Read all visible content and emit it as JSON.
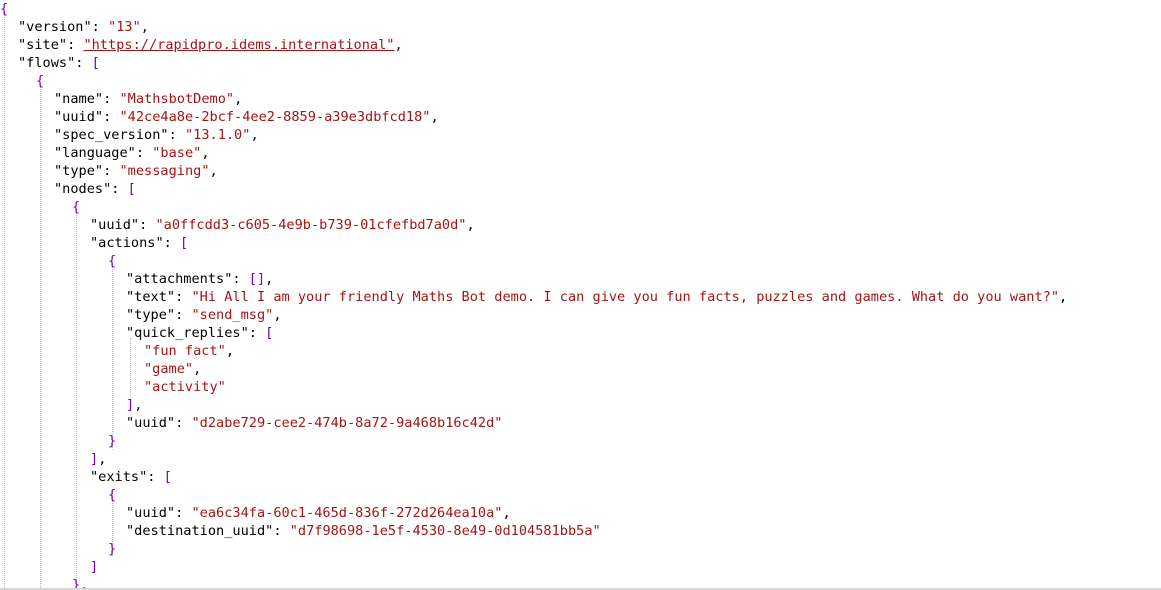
{
  "lines": [
    [
      [
        "p",
        "{"
      ]
    ],
    [
      [
        "k",
        "\"version\""
      ],
      [
        "k",
        ": "
      ],
      [
        "s",
        "\"13\""
      ],
      [
        "k",
        ","
      ]
    ],
    [
      [
        "k",
        "\"site\""
      ],
      [
        "k",
        ": "
      ],
      [
        "lnk",
        "\"https://rapidpro.idems.international\""
      ],
      [
        "k",
        ","
      ]
    ],
    [
      [
        "k",
        "\"flows\""
      ],
      [
        "k",
        ": "
      ],
      [
        "p",
        "["
      ]
    ],
    [
      [
        "p",
        "{"
      ]
    ],
    [
      [
        "k",
        "\"name\""
      ],
      [
        "k",
        ": "
      ],
      [
        "s",
        "\"MathsbotDemo\""
      ],
      [
        "k",
        ","
      ]
    ],
    [
      [
        "k",
        "\"uuid\""
      ],
      [
        "k",
        ": "
      ],
      [
        "s",
        "\"42ce4a8e-2bcf-4ee2-8859-a39e3dbfcd18\""
      ],
      [
        "k",
        ","
      ]
    ],
    [
      [
        "k",
        "\"spec_version\""
      ],
      [
        "k",
        ": "
      ],
      [
        "s",
        "\"13.1.0\""
      ],
      [
        "k",
        ","
      ]
    ],
    [
      [
        "k",
        "\"language\""
      ],
      [
        "k",
        ": "
      ],
      [
        "s",
        "\"base\""
      ],
      [
        "k",
        ","
      ]
    ],
    [
      [
        "k",
        "\"type\""
      ],
      [
        "k",
        ": "
      ],
      [
        "s",
        "\"messaging\""
      ],
      [
        "k",
        ","
      ]
    ],
    [
      [
        "k",
        "\"nodes\""
      ],
      [
        "k",
        ": "
      ],
      [
        "p",
        "["
      ]
    ],
    [
      [
        "p",
        "{"
      ]
    ],
    [
      [
        "k",
        "\"uuid\""
      ],
      [
        "k",
        ": "
      ],
      [
        "s",
        "\"a0ffcdd3-c605-4e9b-b739-01cfefbd7a0d\""
      ],
      [
        "k",
        ","
      ]
    ],
    [
      [
        "k",
        "\"actions\""
      ],
      [
        "k",
        ": "
      ],
      [
        "p",
        "["
      ]
    ],
    [
      [
        "p",
        "{"
      ]
    ],
    [
      [
        "k",
        "\"attachments\""
      ],
      [
        "k",
        ": "
      ],
      [
        "p",
        "[]"
      ],
      [
        "k",
        ","
      ]
    ],
    [
      [
        "k",
        "\"text\""
      ],
      [
        "k",
        ": "
      ],
      [
        "s",
        "\"Hi All I am your friendly Maths Bot demo. I can give you fun facts, puzzles and games. What do you want?\""
      ],
      [
        "k",
        ","
      ]
    ],
    [
      [
        "k",
        "\"type\""
      ],
      [
        "k",
        ": "
      ],
      [
        "s",
        "\"send_msg\""
      ],
      [
        "k",
        ","
      ]
    ],
    [
      [
        "k",
        "\"quick_replies\""
      ],
      [
        "k",
        ": "
      ],
      [
        "p",
        "["
      ]
    ],
    [
      [
        "s",
        "\"fun fact\""
      ],
      [
        "k",
        ","
      ]
    ],
    [
      [
        "s",
        "\"game\""
      ],
      [
        "k",
        ","
      ]
    ],
    [
      [
        "s",
        "\"activity\""
      ]
    ],
    [
      [
        "p",
        "]"
      ],
      [
        "k",
        ","
      ]
    ],
    [
      [
        "k",
        "\"uuid\""
      ],
      [
        "k",
        ": "
      ],
      [
        "s",
        "\"d2abe729-cee2-474b-8a72-9a468b16c42d\""
      ]
    ],
    [
      [
        "p",
        "}"
      ]
    ],
    [
      [
        "p",
        "]"
      ],
      [
        "k",
        ","
      ]
    ],
    [
      [
        "k",
        "\"exits\""
      ],
      [
        "k",
        ": "
      ],
      [
        "p",
        "["
      ]
    ],
    [
      [
        "p",
        "{"
      ]
    ],
    [
      [
        "k",
        "\"uuid\""
      ],
      [
        "k",
        ": "
      ],
      [
        "s",
        "\"ea6c34fa-60c1-465d-836f-272d264ea10a\""
      ],
      [
        "k",
        ","
      ]
    ],
    [
      [
        "k",
        "\"destination_uuid\""
      ],
      [
        "k",
        ": "
      ],
      [
        "s",
        "\"d7f98698-1e5f-4530-8e49-0d104581bb5a\""
      ]
    ],
    [
      [
        "p",
        "}"
      ]
    ],
    [
      [
        "p",
        "]"
      ]
    ],
    [
      [
        "p",
        "},"
      ]
    ]
  ],
  "colors": {
    "key": "#000000",
    "string": "#a31515",
    "punctuation": "#7000c8",
    "guide": "#b8b8b8",
    "background": "#ffffff"
  }
}
